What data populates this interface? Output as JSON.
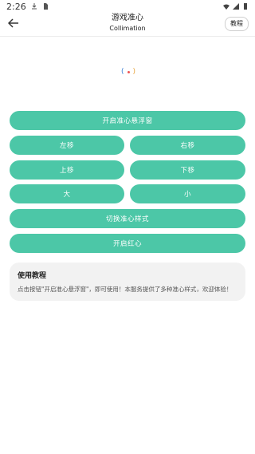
{
  "status": {
    "time": "2:26"
  },
  "header": {
    "title": "游戏准心",
    "subtitle": "Collimation",
    "tutorial_button": "教程"
  },
  "colors": {
    "accent": "#4cc7a7",
    "card_bg": "#f2f2f2"
  },
  "crosshair": {
    "left_bracket": "(",
    "right_bracket": ")"
  },
  "buttons": {
    "open_window": "开启准心悬浮窗",
    "move_left": "左移",
    "move_right": "右移",
    "move_up": "上移",
    "move_down": "下移",
    "bigger": "大",
    "smaller": "小",
    "switch_style": "切换准心样式",
    "red_heart": "开启红心"
  },
  "card": {
    "title": "使用教程",
    "description": "点击按钮\"开启准心悬浮窗\"，即可使用！本服务提供了多种准心样式，欢迎体验！"
  }
}
